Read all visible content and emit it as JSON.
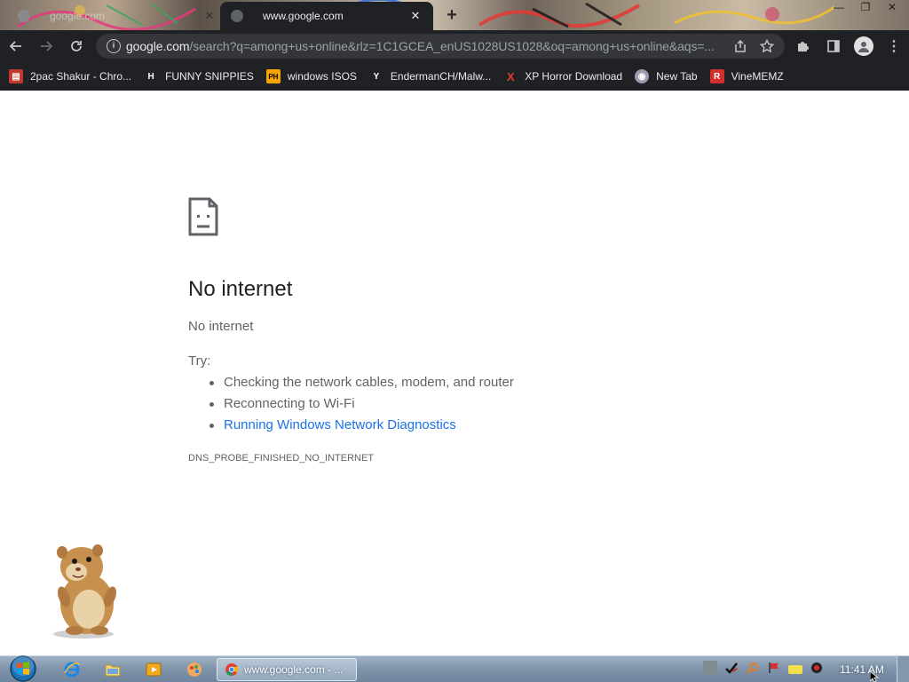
{
  "tabs": [
    {
      "label": "google.com",
      "active": false
    },
    {
      "label": "www.google.com",
      "active": true
    }
  ],
  "omnibox": {
    "domain": "google.com",
    "path": "/search?q=among+us+online&rlz=1C1GCEA_enUS1028US1028&oq=among+us+online&aqs=..."
  },
  "bookmarks": [
    {
      "label": "2pac Shakur - Chro...",
      "icon": "bookmark-icon",
      "color": "#c0392b"
    },
    {
      "label": "FUNNY SNIPPIES",
      "icon": "H",
      "color": "#ffffff"
    },
    {
      "label": "windows ISOS",
      "icon": "PH",
      "color": "#f7a400"
    },
    {
      "label": "EndermanCH/Malw...",
      "icon": "Y",
      "color": "#ffffff"
    },
    {
      "label": "XP Horror Download",
      "icon": "X",
      "color": "#e53935"
    },
    {
      "label": "New Tab",
      "icon": "globe-icon",
      "color": "#9e9ab0"
    },
    {
      "label": "VineMEMZ",
      "icon": "R",
      "color": "#d32f2f"
    }
  ],
  "error": {
    "title": "No internet",
    "subtitle": "No internet",
    "try_label": "Try:",
    "suggestions": [
      {
        "text": "Checking the network cables, modem, and router",
        "link": false
      },
      {
        "text": "Reconnecting to Wi-Fi",
        "link": false
      },
      {
        "text": "Running Windows Network Diagnostics",
        "link": true
      }
    ],
    "code": "DNS_PROBE_FINISHED_NO_INTERNET"
  },
  "taskbar": {
    "active_task": "www.google.com - ...",
    "clock": "11:41 AM"
  },
  "colors": {
    "chrome_dark": "#202124",
    "omnibox_bg": "#35363a",
    "link_blue": "#1a73e8",
    "error_text": "#5f6368"
  }
}
